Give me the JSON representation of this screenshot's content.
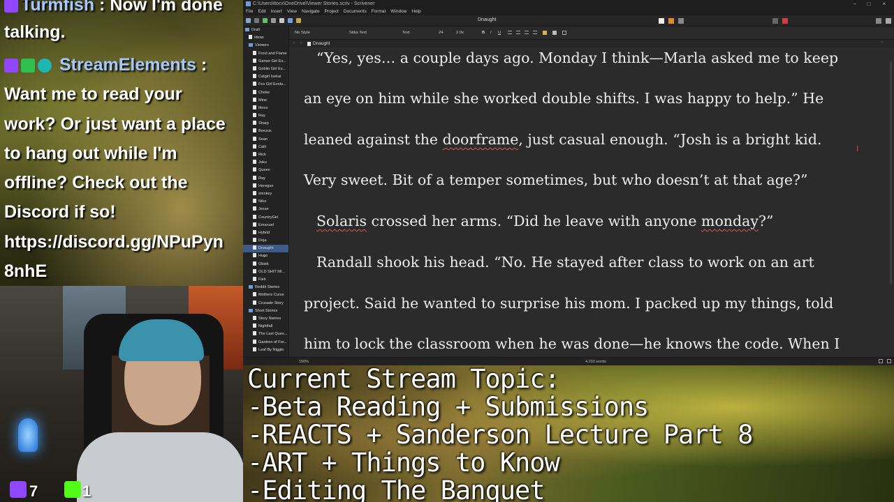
{
  "chat": {
    "line1_user": "Turmfish",
    "line1_sep": ":",
    "line1_text": "Now I'm done",
    "line2": "talking.",
    "line3_user": "StreamElements",
    "line3_sep": ":",
    "lines": [
      "Want me to read your",
      "work? Or just want a place",
      "to hang out while I'm",
      "offline? Check out the",
      "Discord if so!",
      "https://discord.gg/NPuPyn",
      "8nhE"
    ]
  },
  "counts": {
    "twitch_count": "7",
    "kick_count": "1"
  },
  "window": {
    "title": "C:\\Users\\ttocx\\OneDrive\\Viewer Stories.scriv - Scrivener",
    "doc_title": "Dnaught",
    "menu": [
      "File",
      "Edit",
      "Insert",
      "View",
      "Navigate",
      "Project",
      "Documents",
      "Format",
      "Window",
      "Help"
    ]
  },
  "formatbar": {
    "style": "No Style",
    "font": "Sitka Text",
    "face": "Text",
    "size": "24",
    "spacing": "2.0x",
    "buttons": [
      "B",
      "I",
      "U"
    ]
  },
  "header": {
    "doc_name": "Dnaught"
  },
  "binder": {
    "items": [
      {
        "label": "Draft",
        "type": "folder",
        "indent": 0
      },
      {
        "label": "Ideas",
        "type": "file",
        "indent": 1
      },
      {
        "label": "Viewers",
        "type": "folder",
        "indent": 1
      },
      {
        "label": "Frost and Flame",
        "type": "file",
        "indent": 2
      },
      {
        "label": "Gamer Girl Ev...",
        "type": "file",
        "indent": 2
      },
      {
        "label": "Goblin Girl Ev...",
        "type": "file",
        "indent": 2
      },
      {
        "label": "Catgirl Isekai",
        "type": "file",
        "indent": 2
      },
      {
        "label": "Fox Girl Evolu...",
        "type": "file",
        "indent": 2
      },
      {
        "label": "Choke",
        "type": "file",
        "indent": 2
      },
      {
        "label": "Mine",
        "type": "file",
        "indent": 2
      },
      {
        "label": "Ittocs",
        "type": "file",
        "indent": 2
      },
      {
        "label": "Ray",
        "type": "file",
        "indent": 2
      },
      {
        "label": "Sharp",
        "type": "file",
        "indent": 2
      },
      {
        "label": "Beezus",
        "type": "file",
        "indent": 2
      },
      {
        "label": "Sean",
        "type": "file",
        "indent": 2
      },
      {
        "label": "Calli",
        "type": "file",
        "indent": 2
      },
      {
        "label": "Rick",
        "type": "file",
        "indent": 2
      },
      {
        "label": "Joku",
        "type": "file",
        "indent": 2
      },
      {
        "label": "Queen",
        "type": "file",
        "indent": 2
      },
      {
        "label": "Ray",
        "type": "file",
        "indent": 2
      },
      {
        "label": "Heregue",
        "type": "file",
        "indent": 2
      },
      {
        "label": "smokey",
        "type": "file",
        "indent": 2
      },
      {
        "label": "Niko",
        "type": "file",
        "indent": 2
      },
      {
        "label": "Jesse",
        "type": "file",
        "indent": 2
      },
      {
        "label": "CountryGirl",
        "type": "file",
        "indent": 2
      },
      {
        "label": "Emanuel",
        "type": "file",
        "indent": 2
      },
      {
        "label": "Hybrid",
        "type": "file",
        "indent": 2
      },
      {
        "label": "Doja",
        "type": "file",
        "indent": 2
      },
      {
        "label": "Dnaught",
        "type": "file",
        "indent": 2,
        "selected": true
      },
      {
        "label": "Hugo",
        "type": "file",
        "indent": 2
      },
      {
        "label": "Obiek",
        "type": "file",
        "indent": 2
      },
      {
        "label": "OLD SHIT MI...",
        "type": "file",
        "indent": 2
      },
      {
        "label": "Fish",
        "type": "file",
        "indent": 2
      },
      {
        "label": "Reddit Stories",
        "type": "folder",
        "indent": 1
      },
      {
        "label": "Mothers Curse",
        "type": "file",
        "indent": 2
      },
      {
        "label": "Crusade Story",
        "type": "file",
        "indent": 2
      },
      {
        "label": "Short Stories",
        "type": "folder",
        "indent": 1
      },
      {
        "label": "Story Names",
        "type": "file",
        "indent": 2
      },
      {
        "label": "Nightfall",
        "type": "file",
        "indent": 2
      },
      {
        "label": "The Last Ques...",
        "type": "file",
        "indent": 2
      },
      {
        "label": "Gardren of For...",
        "type": "file",
        "indent": 2
      },
      {
        "label": "Leaf By Niggle",
        "type": "file",
        "indent": 2
      }
    ]
  },
  "editor": {
    "l1": "“Yes, yes… a couple days ago. Monday I think—Marla asked me to keep",
    "l2": "an eye on him while she worked double shifts. I was happy to help.” He",
    "l3a": "leaned against the ",
    "l3b": "doorframe",
    "l3c": ", just casual enough. “Josh is a bright kid.",
    "l4": "Very sweet. Bit of a temper sometimes, but who doesn’t at that age?”",
    "l5a": "Solaris",
    "l5b": " crossed her arms. “Did he leave with anyone ",
    "l5c": "monday",
    "l5d": "?”",
    "l6": "Randall shook his head. “No. He stayed after class to work on an art",
    "l7": "project. Said he wanted to surprise his mom. I packed up my things, told",
    "l8": "him to lock the classroom when he was done—he knows the code. When I"
  },
  "footer": {
    "zoom": "150%",
    "word_count": "4,202 words"
  },
  "topic": {
    "lines": [
      "Current Stream Topic:",
      "-Beta Reading + Submissions",
      "-REACTS + Sanderson Lecture Part 8",
      "-ART + Things to Know",
      "-Editing The Banquet"
    ]
  },
  "colors": {
    "accent_selected": "#3d5b86",
    "twitch": "#9146ff",
    "kick": "#53fc18",
    "spell_underline": "#d9534f"
  }
}
